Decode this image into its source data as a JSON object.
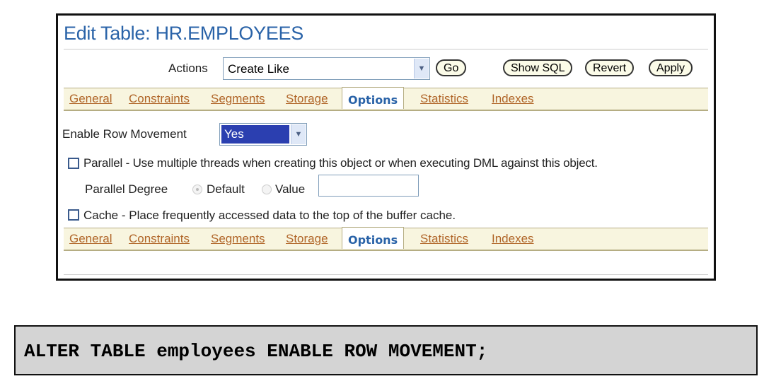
{
  "title": "Edit Table: HR.EMPLOYEES",
  "actions": {
    "label": "Actions",
    "value": "Create Like",
    "go": "Go"
  },
  "buttons": {
    "show_sql": "Show SQL",
    "revert": "Revert",
    "apply": "Apply"
  },
  "tabs": [
    "General",
    "Constraints",
    "Segments",
    "Storage",
    "Options",
    "Statistics",
    "Indexes"
  ],
  "active_tab": "Options",
  "row_movement": {
    "label": "Enable Row Movement",
    "value": "Yes"
  },
  "parallel": {
    "label": "Parallel - Use multiple threads when creating this object or when executing DML against this object.",
    "checked": false,
    "degree_label": "Parallel Degree",
    "default_label": "Default",
    "value_label": "Value",
    "value": "",
    "selected": "Default"
  },
  "cache": {
    "label": "Cache - Place frequently accessed data to the top of the buffer cache.",
    "checked": false
  },
  "sql": "ALTER TABLE employees ENABLE ROW MOVEMENT;",
  "colors": {
    "title": "#2a63a8",
    "tab_link": "#b06528",
    "tab_bar": "#f8f5df"
  }
}
